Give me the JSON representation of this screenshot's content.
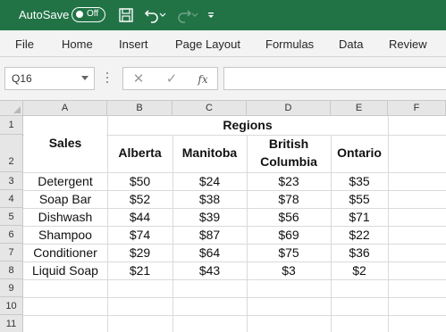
{
  "titlebar": {
    "autosave_label": "AutoSave",
    "autosave_state": "Off",
    "icons": [
      "save-icon",
      "undo-icon",
      "undo-dropdown-icon",
      "redo-icon",
      "redo-dropdown-icon",
      "customize-toolbar-icon"
    ],
    "background": "#217346"
  },
  "menu": {
    "items": [
      "File",
      "Home",
      "Insert",
      "Page Layout",
      "Formulas",
      "Data",
      "Review"
    ]
  },
  "formula_bar": {
    "name_box": "Q16",
    "cancel_icon": "close-icon",
    "enter_icon": "check-icon",
    "function_label": "fx",
    "formula": ""
  },
  "sheet": {
    "columns": [
      "A",
      "B",
      "C",
      "D",
      "E",
      "F"
    ],
    "rows": [
      "1",
      "2",
      "3",
      "4",
      "5",
      "6",
      "7",
      "8",
      "9",
      "10",
      "11"
    ],
    "header_regions": "Regions",
    "header_sales": "Sales",
    "regions": [
      "Alberta",
      "Manitoba",
      "British",
      "Columbia",
      "Ontario"
    ],
    "data": [
      [
        "Detergent",
        "$50",
        "$24",
        "$23",
        "$35"
      ],
      [
        "Soap Bar",
        "$52",
        "$38",
        "$78",
        "$55"
      ],
      [
        "Dishwash",
        "$44",
        "$39",
        "$56",
        "$71"
      ],
      [
        "Shampoo",
        "$74",
        "$87",
        "$69",
        "$22"
      ],
      [
        "Conditioner",
        "$29",
        "$64",
        "$75",
        "$36"
      ],
      [
        "Liquid Soap",
        "$21",
        "$43",
        "$3",
        "$2"
      ]
    ]
  }
}
